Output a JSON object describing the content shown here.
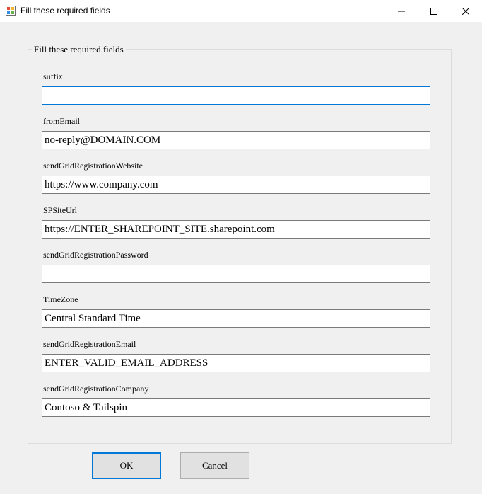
{
  "window": {
    "title": "Fill these required fields",
    "icon": "form-app-icon",
    "controls": [
      "minimize-icon",
      "maximize-icon",
      "close-icon"
    ]
  },
  "group": {
    "legend": "Fill these required fields"
  },
  "fields": [
    {
      "label": "suffix",
      "value": "",
      "focused": true
    },
    {
      "label": "fromEmail",
      "value": "no-reply@DOMAIN.COM"
    },
    {
      "label": "sendGridRegistrationWebsite",
      "value": "https://www.company.com"
    },
    {
      "label": "SPSiteUrl",
      "value": "https://ENTER_SHAREPOINT_SITE.sharepoint.com"
    },
    {
      "label": "sendGridRegistrationPassword",
      "value": ""
    },
    {
      "label": "TimeZone",
      "value": "Central Standard Time"
    },
    {
      "label": "sendGridRegistrationEmail",
      "value": "ENTER_VALID_EMAIL_ADDRESS"
    },
    {
      "label": "sendGridRegistrationCompany",
      "value": "Contoso & Tailspin"
    }
  ],
  "buttons": {
    "ok": "OK",
    "cancel": "Cancel"
  },
  "colors": {
    "accent": "#0078d7",
    "background": "#f0f0f0"
  }
}
